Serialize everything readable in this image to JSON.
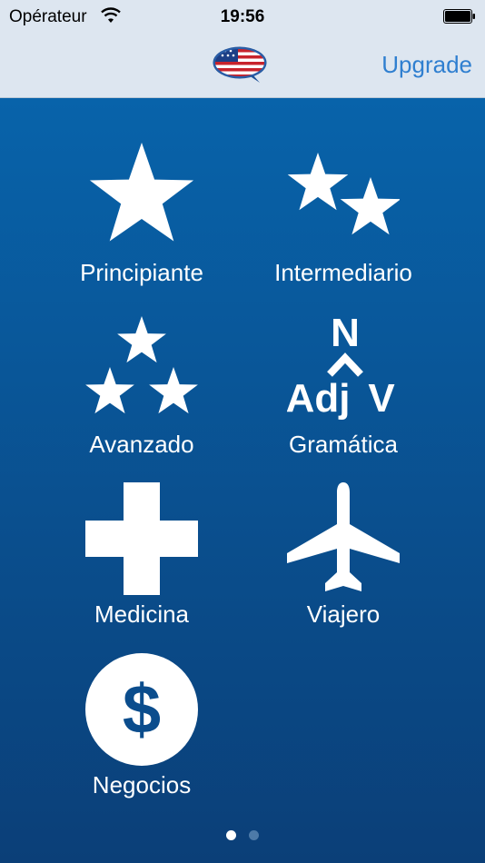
{
  "status_bar": {
    "carrier": "Opérateur",
    "time": "19:56"
  },
  "nav": {
    "upgrade_label": "Upgrade",
    "logo_icon": "us-flag-speech-bubble-icon"
  },
  "categories": [
    {
      "label": "Principiante",
      "icon": "star-icon"
    },
    {
      "label": "Intermediario",
      "icon": "two-stars-icon"
    },
    {
      "label": "Avanzado",
      "icon": "three-stars-icon"
    },
    {
      "label": "Gramática",
      "icon": "grammar-icon",
      "icon_text": [
        "N",
        "Adj",
        "V"
      ]
    },
    {
      "label": "Medicina",
      "icon": "medical-cross-icon"
    },
    {
      "label": "Viajero",
      "icon": "airplane-icon"
    },
    {
      "label": "Negocios",
      "icon": "dollar-coin-icon",
      "icon_text": [
        "$"
      ]
    }
  ],
  "pager": {
    "pages": 2,
    "current": 1
  },
  "colors": {
    "accent": "#2f7fd0",
    "background_top": "#0863aa",
    "background_bottom": "#0b3f78",
    "nav_bg": "#dde6f0"
  }
}
